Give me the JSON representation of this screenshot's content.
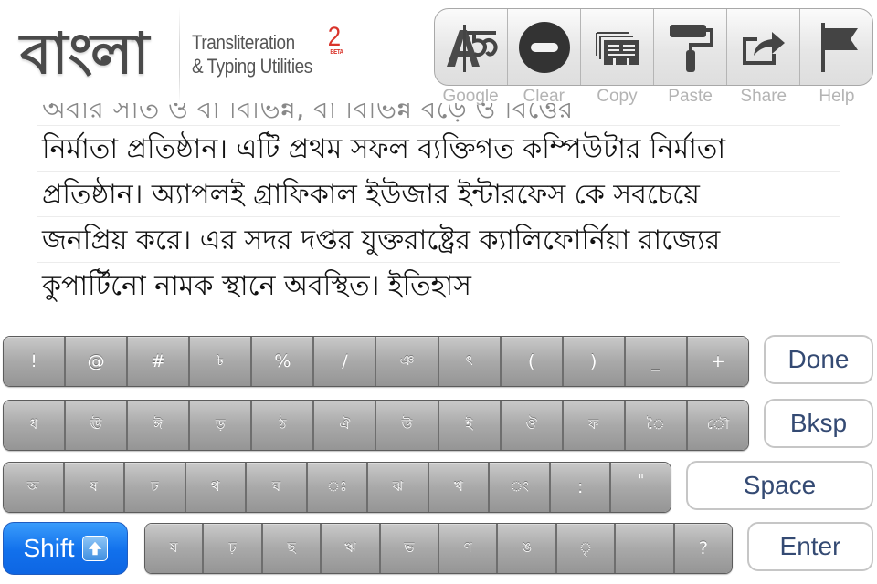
{
  "header": {
    "logo_text": "বাংলা",
    "subtitle_line1": "Transliteration",
    "subtitle_line2": "& Typing Utilities",
    "version": "2",
    "beta_label": "BETA",
    "accent_color": "#d9342b"
  },
  "toolbar": {
    "items": [
      {
        "label": "Google",
        "icon": "google-transliterate-icon"
      },
      {
        "label": "Clear",
        "icon": "clear-minus-circle-icon"
      },
      {
        "label": "Copy",
        "icon": "copy-stack-icon"
      },
      {
        "label": "Paste",
        "icon": "paint-roller-icon"
      },
      {
        "label": "Share",
        "icon": "share-arrow-icon"
      },
      {
        "label": "Help",
        "icon": "flag-icon"
      }
    ]
  },
  "editor": {
    "partial_line": "অবার সাত ও বা বিভিন্ন, বা বিভিন্ন বড়ে ও বিত্তের",
    "lines": [
      "নির্মাতা প্রতিষ্ঠান। এটি প্রথম সফল ব্যক্তিগত কম্পিউটার নির্মাতা",
      "প্রতিষ্ঠান। অ্যাপলই গ্রাফিকাল ইউজার ইন্টারফেস কে সবচেয়ে",
      "জনপ্রিয় করে। এর সদর দপ্তর যুক্তরাষ্ট্রের ক্যালিফোর্নিয়া রাজ্যের",
      "কুপার্টিনো নামক স্থানে অবস্থিত। ইতিহাস"
    ]
  },
  "keyboard": {
    "row1": [
      "!",
      "@",
      "#",
      "৳",
      "%",
      "/",
      "ঞ",
      "ৎ",
      "(",
      ")",
      "_",
      "+"
    ],
    "row2": [
      "ধ",
      "ঊ",
      "ঈ",
      "ড়",
      "ঠ",
      "ঐ",
      "উ",
      "ই",
      "ঔ",
      "ফ",
      "ৈ",
      "ৌ"
    ],
    "row3": [
      "অ",
      "ষ",
      "ঢ",
      "থ",
      "ঘ",
      "ঃ",
      "ঝ",
      "খ",
      "ং",
      ":",
      "\""
    ],
    "row4": [
      "য",
      "ঢ়",
      "ছ",
      "ঋ",
      "ভ",
      "ণ",
      "ঙ",
      "ৃ",
      "",
      "?"
    ],
    "done_label": "Done",
    "bksp_label": "Bksp",
    "space_label": "Space",
    "enter_label": "Enter",
    "shift_label": "Shift",
    "shift_color": "#1170ec",
    "side_text_color": "#344a73"
  }
}
